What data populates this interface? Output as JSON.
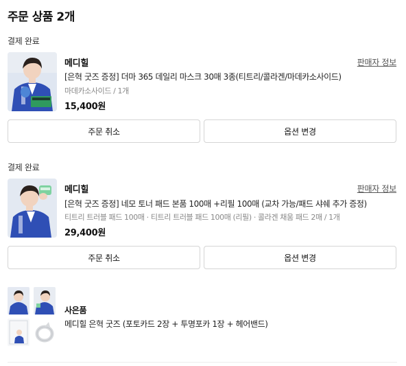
{
  "page": {
    "title": "주문 상품 2개"
  },
  "orders": [
    {
      "status": "결제 완료",
      "brand": "메디힐",
      "seller_link": "판매자 정보",
      "product_name": "[은혁 굿즈 증정] 더마 365 데일리 마스크 30매 3종(티트리/콜라겐/마데카소사이드)",
      "option": "마데카소사이드 / 1개",
      "price": "15,400원",
      "cancel_label": "주문 취소",
      "change_label": "옵션 변경"
    },
    {
      "status": "결제 완료",
      "brand": "메디힐",
      "seller_link": "판매자 정보",
      "product_name": "[은혁 굿즈 증정] 네모 토너 패드 본품 100매 +리필 100매 (교차 가능/패드 샤쉐 추가 증정)",
      "option": "티트리 트러블 패드 100매 · 티트리 트러블 패드 100매 (리필) · 콜라겐 채움 패드 2매 / 1개",
      "price": "29,400원",
      "cancel_label": "주문 취소",
      "change_label": "옵션 변경"
    }
  ],
  "gift": {
    "label": "사은품",
    "description": "메디힐 은혁 굿즈 (포토카드 2장 + 투명포카 1장 + 헤어밴드)"
  },
  "colors": {
    "jacket": "#2f4fb5",
    "mask_green": "#2f9a5e",
    "text_muted": "#888888"
  }
}
